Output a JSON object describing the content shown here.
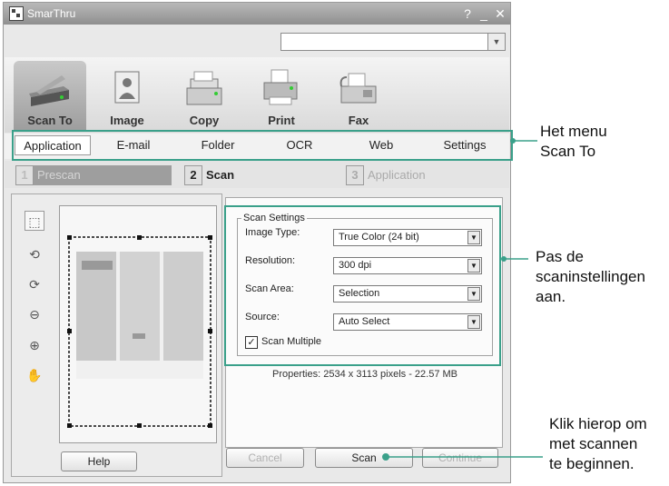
{
  "window": {
    "title": "SmarThru"
  },
  "icon_tabs": [
    {
      "label": "Scan To",
      "icon": "scanner-icon"
    },
    {
      "label": "Image",
      "icon": "image-icon"
    },
    {
      "label": "Copy",
      "icon": "copier-icon"
    },
    {
      "label": "Print",
      "icon": "printer-icon"
    },
    {
      "label": "Fax",
      "icon": "fax-icon"
    }
  ],
  "sub_tabs": [
    "Application",
    "E-mail",
    "Folder",
    "OCR",
    "Web",
    "Settings"
  ],
  "steps": [
    {
      "num": "1",
      "label": "Prescan"
    },
    {
      "num": "2",
      "label": "Scan"
    },
    {
      "num": "3",
      "label": "Application"
    }
  ],
  "scan_settings": {
    "legend": "Scan Settings",
    "image_type_label": "Image Type:",
    "image_type_value": "True Color (24 bit)",
    "resolution_label": "Resolution:",
    "resolution_value": "300 dpi",
    "scan_area_label": "Scan Area:",
    "scan_area_value": "Selection",
    "source_label": "Source:",
    "source_value": "Auto Select",
    "scan_multiple_label": "Scan Multiple",
    "scan_multiple_checked": true
  },
  "properties": "Properties: 2534 x 3113 pixels - 22.57 MB",
  "buttons": {
    "help": "Help",
    "cancel": "Cancel",
    "scan": "Scan",
    "continue": "Continue"
  },
  "annotations": {
    "menu": [
      "Het menu",
      "Scan To"
    ],
    "settings": [
      "Pas de",
      "scaninstellingen",
      "aan."
    ],
    "scan": [
      "Klik hierop om",
      "met scannen",
      "te beginnen."
    ]
  },
  "colors": {
    "callout_line": "#3aa08a"
  }
}
